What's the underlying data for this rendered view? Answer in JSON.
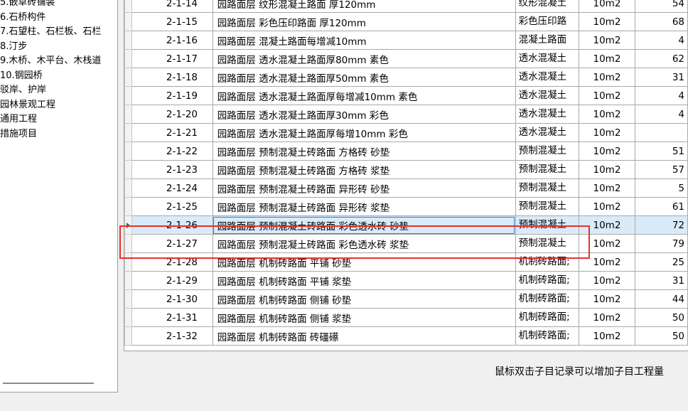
{
  "tree": {
    "items": [
      "5.嵌草砖铺装",
      "6.石桥构件",
      "7.石望柱、石栏板、石栏",
      "8.汀步",
      "9.木桥、木平台、木栈道",
      "10.钢园桥",
      " 驳岸、护岸",
      "园林景观工程",
      "通用工程",
      "措施项目"
    ]
  },
  "grid": {
    "rows": [
      {
        "code": "2-1-14",
        "name": "园路面层 纹形混凝土路面 厚120mm",
        "short": "纹形混凝土",
        "unit": "10m2",
        "qty": "54"
      },
      {
        "code": "2-1-15",
        "name": "园路面层 彩色压印路面 厚120mm",
        "short": "彩色压印路",
        "unit": "10m2",
        "qty": "68"
      },
      {
        "code": "2-1-16",
        "name": "园路面层 混凝土路面每增减10mm",
        "short": "混凝土路面",
        "unit": "10m2",
        "qty": "4"
      },
      {
        "code": "2-1-17",
        "name": "园路面层 透水混凝土路面厚80mm 素色",
        "short": "透水混凝土",
        "unit": "10m2",
        "qty": "62"
      },
      {
        "code": "2-1-18",
        "name": "园路面层 透水混凝土路面厚50mm 素色",
        "short": "透水混凝土",
        "unit": "10m2",
        "qty": "31"
      },
      {
        "code": "2-1-19",
        "name": "园路面层 透水混凝土路面厚每增减10mm 素色",
        "short": "透水混凝土",
        "unit": "10m2",
        "qty": "4"
      },
      {
        "code": "2-1-20",
        "name": "园路面层 透水混凝土路面厚30mm 彩色",
        "short": "透水混凝土",
        "unit": "10m2",
        "qty": "4"
      },
      {
        "code": "2-1-21",
        "name": "园路面层 透水混凝土路面厚每增10mm 彩色",
        "short": "透水混凝土",
        "unit": "10m2",
        "qty": ""
      },
      {
        "code": "2-1-22",
        "name": "园路面层 预制混凝土砖路面 方格砖 砂垫",
        "short": "预制混凝土",
        "unit": "10m2",
        "qty": "51"
      },
      {
        "code": "2-1-23",
        "name": "园路面层 预制混凝土砖路面 方格砖 浆垫",
        "short": "预制混凝土",
        "unit": "10m2",
        "qty": "57"
      },
      {
        "code": "2-1-24",
        "name": "园路面层 预制混凝土砖路面 异形砖 砂垫",
        "short": "预制混凝土",
        "unit": "10m2",
        "qty": "5"
      },
      {
        "code": "2-1-25",
        "name": "园路面层 预制混凝土砖路面 异形砖 浆垫",
        "short": "预制混凝土",
        "unit": "10m2",
        "qty": "61"
      },
      {
        "code": "2-1-26",
        "name": "园路面层 预制混凝土砖路面 彩色透水砖 砂垫",
        "short": "预制混凝土",
        "unit": "10m2",
        "qty": "72"
      },
      {
        "code": "2-1-27",
        "name": "园路面层 预制混凝土砖路面 彩色透水砖 浆垫",
        "short": "预制混凝土",
        "unit": "10m2",
        "qty": "79"
      },
      {
        "code": "2-1-28",
        "name": "园路面层 机制砖路面 平铺 砂垫",
        "short": "机制砖路面;",
        "unit": "10m2",
        "qty": "25"
      },
      {
        "code": "2-1-29",
        "name": "园路面层 机制砖路面 平铺 浆垫",
        "short": "机制砖路面;",
        "unit": "10m2",
        "qty": "31"
      },
      {
        "code": "2-1-30",
        "name": "园路面层 机制砖路面 侧铺 砂垫",
        "short": "机制砖路面;",
        "unit": "10m2",
        "qty": "44"
      },
      {
        "code": "2-1-31",
        "name": "园路面层 机制砖路面 侧铺 浆垫",
        "short": "机制砖路面;",
        "unit": "10m2",
        "qty": "50"
      },
      {
        "code": "2-1-32",
        "name": "园路面层 机制砖路面 砖礓礤",
        "short": "机制砖路面;",
        "unit": "10m2",
        "qty": "50"
      }
    ],
    "selected_index": 12
  },
  "status": {
    "hint": "鼠标双击子目记录可以增加子目工程量"
  },
  "colors": {
    "selected_row": "#d9ebf9",
    "highlight_box": "#e8302a"
  }
}
